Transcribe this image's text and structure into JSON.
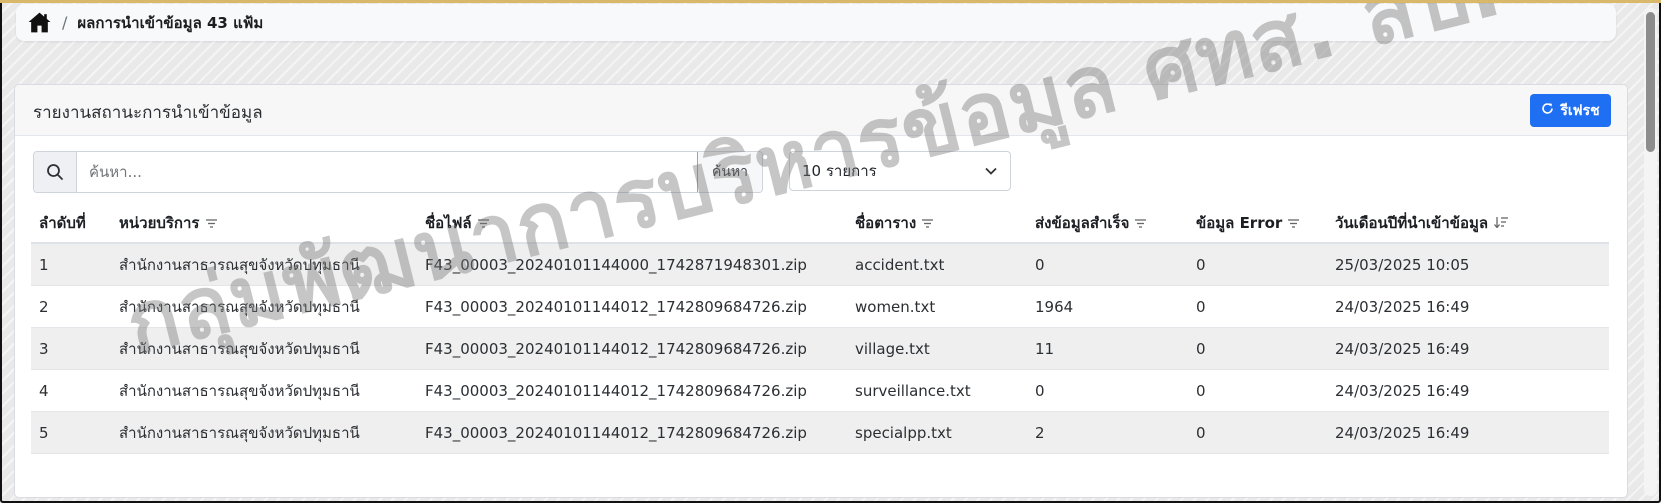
{
  "breadcrumb": {
    "home_icon": "home-icon",
    "separator": "/",
    "current": "ผลการนำเข้าข้อมูล 43 แฟ้ม"
  },
  "card": {
    "title": "รายงานสถานะการนำเข้าข้อมูล",
    "refresh_label": "รีเฟรช",
    "refresh_icon": "refresh-icon",
    "accent_color": "#1f6ff2"
  },
  "search": {
    "placeholder": "ค้นหา...",
    "value": "",
    "button_label": "ค้นหา",
    "icon": "search-icon"
  },
  "page_size": {
    "selected": "10 รายการ",
    "icon": "chevron-down-icon"
  },
  "table": {
    "columns": [
      {
        "label": "ลำดับที่",
        "sort": "none"
      },
      {
        "label": "หน่วยบริการ",
        "sort": "filter"
      },
      {
        "label": "ชื่อไฟล์",
        "sort": "filter"
      },
      {
        "label": "ชื่อตาราง",
        "sort": "filter"
      },
      {
        "label": "ส่งข้อมูลสำเร็จ",
        "sort": "filter"
      },
      {
        "label": "ข้อมูล Error",
        "sort": "filter"
      },
      {
        "label": "วันเดือนปีที่นำเข้าข้อมูล",
        "sort": "descending"
      }
    ],
    "rows": [
      [
        "1",
        "สำนักงานสาธารณสุขจังหวัดปทุมธานี",
        "F43_00003_20240101144000_1742871948301.zip",
        "accident.txt",
        "0",
        "0",
        "25/03/2025 10:05"
      ],
      [
        "2",
        "สำนักงานสาธารณสุขจังหวัดปทุมธานี",
        "F43_00003_20240101144012_1742809684726.zip",
        "women.txt",
        "1964",
        "0",
        "24/03/2025 16:49"
      ],
      [
        "3",
        "สำนักงานสาธารณสุขจังหวัดปทุมธานี",
        "F43_00003_20240101144012_1742809684726.zip",
        "village.txt",
        "11",
        "0",
        "24/03/2025 16:49"
      ],
      [
        "4",
        "สำนักงานสาธารณสุขจังหวัดปทุมธานี",
        "F43_00003_20240101144012_1742809684726.zip",
        "surveillance.txt",
        "0",
        "0",
        "24/03/2025 16:49"
      ],
      [
        "5",
        "สำนักงานสาธารณสุขจังหวัดปทุมธานี",
        "F43_00003_20240101144012_1742809684726.zip",
        "specialpp.txt",
        "2",
        "0",
        "24/03/2025 16:49"
      ]
    ]
  },
  "watermark": {
    "text": "กลุ่มพัฒนาการบริหารข้อมูล ศทส. สป."
  }
}
